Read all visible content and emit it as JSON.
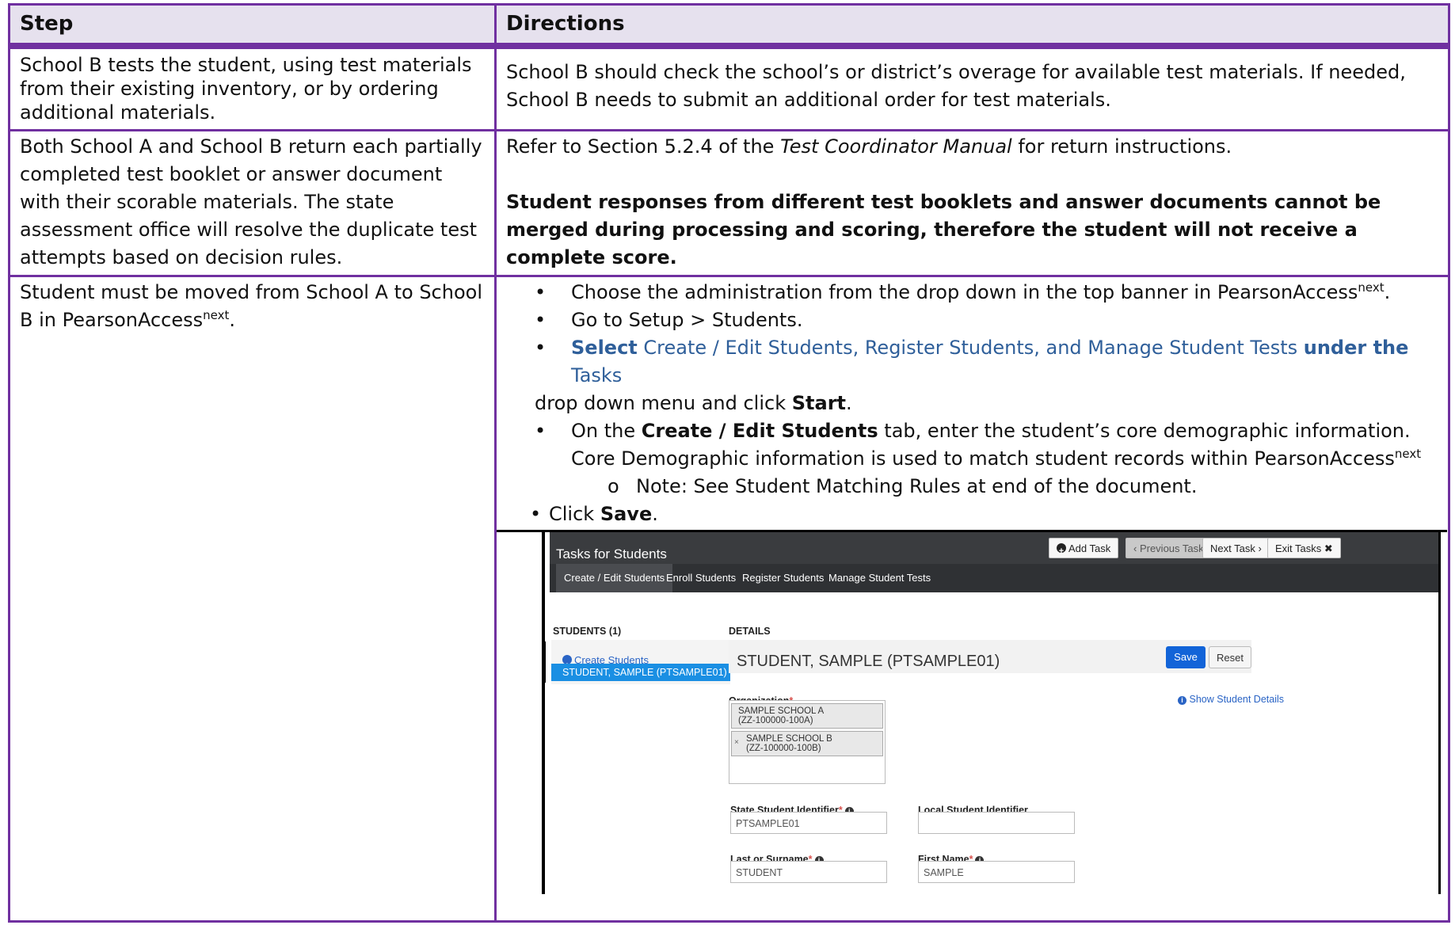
{
  "table": {
    "headers": {
      "step": "Step",
      "directions": "Directions"
    },
    "rows": [
      {
        "step": "School B tests the student, using test materials from their existing inventory, or by ordering additional materials.",
        "directions": "School B should check the school’s or district’s overage for available test materials. If needed, School B needs to submit an additional order for test materials."
      },
      {
        "step": "Both School A and School B return each partially completed test booklet or answer document with their scorable materials. The state assessment office will resolve the duplicate test attempts based on decision rules.",
        "directions_pre": "Refer to Section 5.2.4 of the ",
        "directions_em": "Test Coordinator Manual",
        "directions_post": " for return instructions.",
        "directions_bold": "Student responses from different test booklets and answer documents cannot be merged during processing and scoring, therefore the student will not receive a complete score."
      },
      {
        "step": "Student must be moved from School A to School B in PearsonAccess",
        "step_sup": "next",
        "step_end": ".",
        "b1": "Choose the administration from the drop down in the top banner in PearsonAccess",
        "b1_sup": "next",
        "b1_end": ".",
        "b2": "Go to Setup > Students.",
        "b3_bold1": "Select",
        "b3_blue": " Create / Edit Students, Register Students, and Manage Student Tests ",
        "b3_bold2": "under the",
        "b3_blue2": "Tasks",
        "b3_cont_pre": "drop down menu and click ",
        "b3_cont_bold": "Start",
        "b3_cont_end": ".",
        "b4_pre": "On the ",
        "b4_bold": "Create / Edit Students",
        "b4_post": " tab, enter the student’s core demographic information. Core Demographic information is used to match student records within PearsonAccess",
        "b4_sup": "next",
        "b5": "Note: See Student Matching Rules at end of the document.",
        "b6_pre": "Click ",
        "b6_bold": "Save",
        "b6_end": "."
      }
    ]
  },
  "screenshot": {
    "title": "Tasks for Students",
    "buttons": {
      "add_task": "Add Task",
      "prev_task": "Previous Task",
      "next_task": "Next Task",
      "exit_tasks": "Exit Tasks"
    },
    "tabs": [
      "Create / Edit Students",
      "Enroll Students",
      "Register Students",
      "Manage Student Tests"
    ],
    "students_heading": "STUDENTS (1)",
    "details_heading": "DETAILS",
    "create_students": "Create Students",
    "selected_student": "STUDENT, SAMPLE (PTSAMPLE01)",
    "detail_name": "STUDENT, SAMPLE (PTSAMPLE01)",
    "save": "Save",
    "reset": "Reset",
    "organization_label": "Organization",
    "show_student_details": "Show Student Details",
    "orgs": [
      {
        "name": "SAMPLE SCHOOL A",
        "code": "(ZZ-100000-100A)"
      },
      {
        "name": "SAMPLE SCHOOL B",
        "code": "(ZZ-100000-100B)"
      }
    ],
    "state_id_label": "State Student Identifier",
    "local_id_label": "Local Student Identifier",
    "state_id_value": "PTSAMPLE01",
    "local_id_value": "",
    "last_name_label": "Last or Surname",
    "first_name_label": "First Name",
    "last_name_value": "STUDENT",
    "first_name_value": "SAMPLE",
    "required_mark": "*"
  }
}
